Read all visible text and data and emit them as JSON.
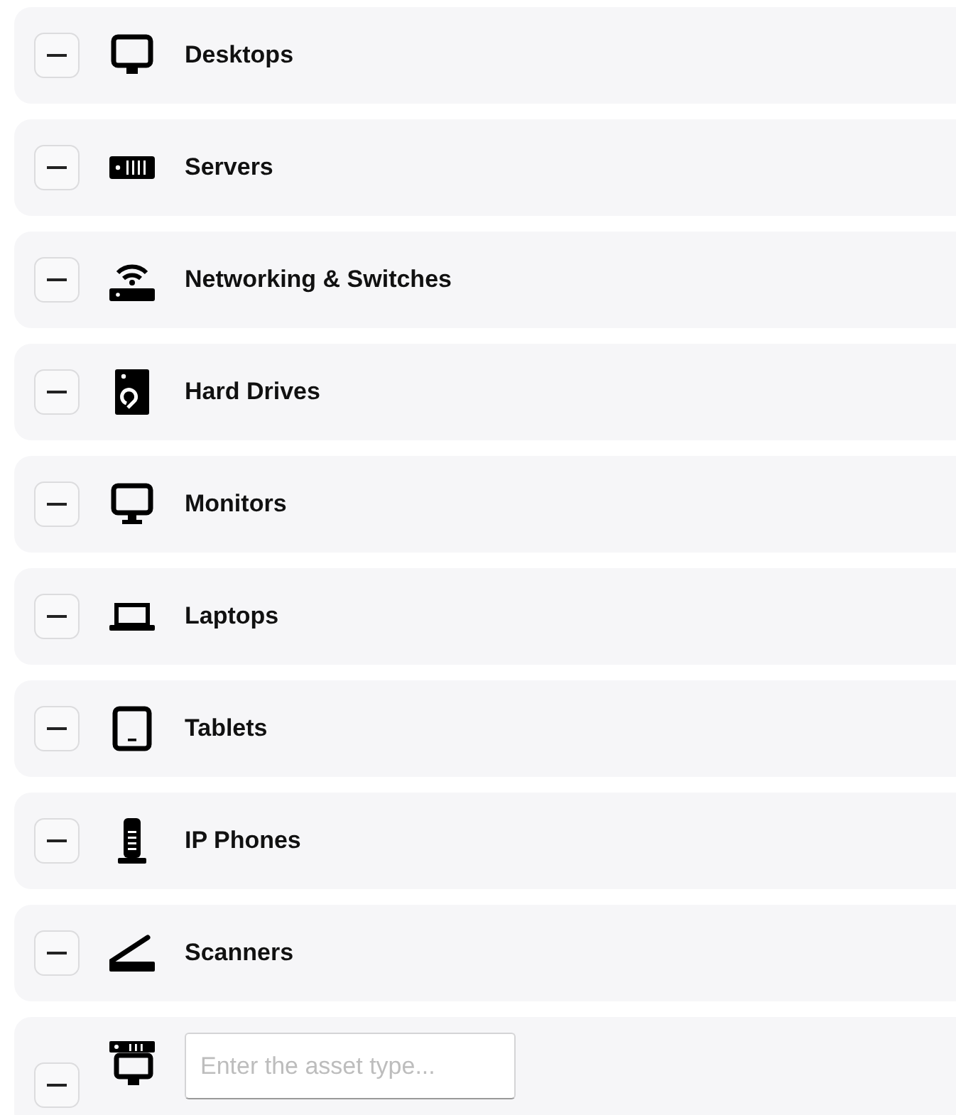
{
  "asset_types": [
    {
      "kind": "category",
      "label": "Desktops"
    },
    {
      "kind": "category",
      "label": "Servers"
    },
    {
      "kind": "category",
      "label": "Networking & Switches"
    },
    {
      "kind": "category",
      "label": "Hard Drives"
    },
    {
      "kind": "category",
      "label": "Monitors"
    },
    {
      "kind": "category",
      "label": "Laptops"
    },
    {
      "kind": "category",
      "label": "Tablets"
    },
    {
      "kind": "category",
      "label": "IP Phones"
    },
    {
      "kind": "category",
      "label": "Scanners"
    },
    {
      "kind": "new",
      "placeholder": "Enter the asset type..."
    }
  ]
}
